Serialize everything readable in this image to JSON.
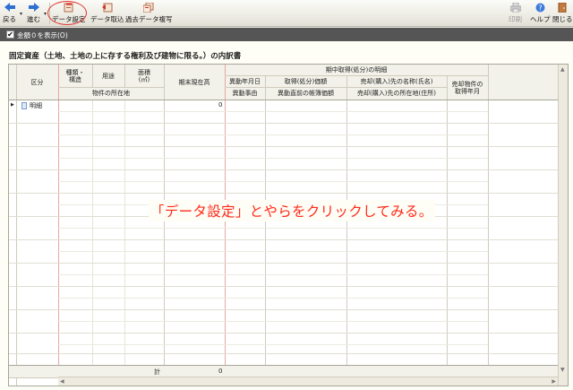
{
  "toolbar": {
    "back_label": "戻る",
    "forward_label": "進む",
    "data_settings_label": "データ設定",
    "data_import_label": "データ取込",
    "past_data_copy_label": "過去データ複写",
    "print_label": "印刷",
    "help_label": "ヘルプ",
    "close_label": "閉じる"
  },
  "options": {
    "show_zero_amounts_label": "金額０を表示(O)",
    "checked": true
  },
  "page_title": "固定資産（土地、土地の上に存する権利及び建物に限る。）の内訳書",
  "table": {
    "headers": {
      "category": "区分",
      "kind_structure": "種類・\n構造",
      "use": "用途",
      "area": "面積\n(㎡)",
      "location": "物件の所在地",
      "period_end_balance": "期末現在高",
      "period_group": "期中取得(処分)の明細",
      "change_date": "異動年月日",
      "change_reason": "異動事由",
      "acquisition_price": "取得(処分)価額",
      "book_value_before": "異動直前の帳簿価額",
      "seller_buyer_name": "売却(購入)先の名称(氏名)",
      "seller_buyer_address": "売却(購入)先の所在地(住所)",
      "sold_acquired_date": "売却物件の\n取得年月"
    },
    "rows": [
      {
        "category": "明細",
        "period_end_balance": "0"
      }
    ],
    "total_label": "計",
    "total_value": "0"
  },
  "caption": "「データ設定」とやらをクリックしてみる。",
  "colors": {
    "annotation_red": "#ff2a1a",
    "grid_red_line": "#e8a6a0"
  }
}
